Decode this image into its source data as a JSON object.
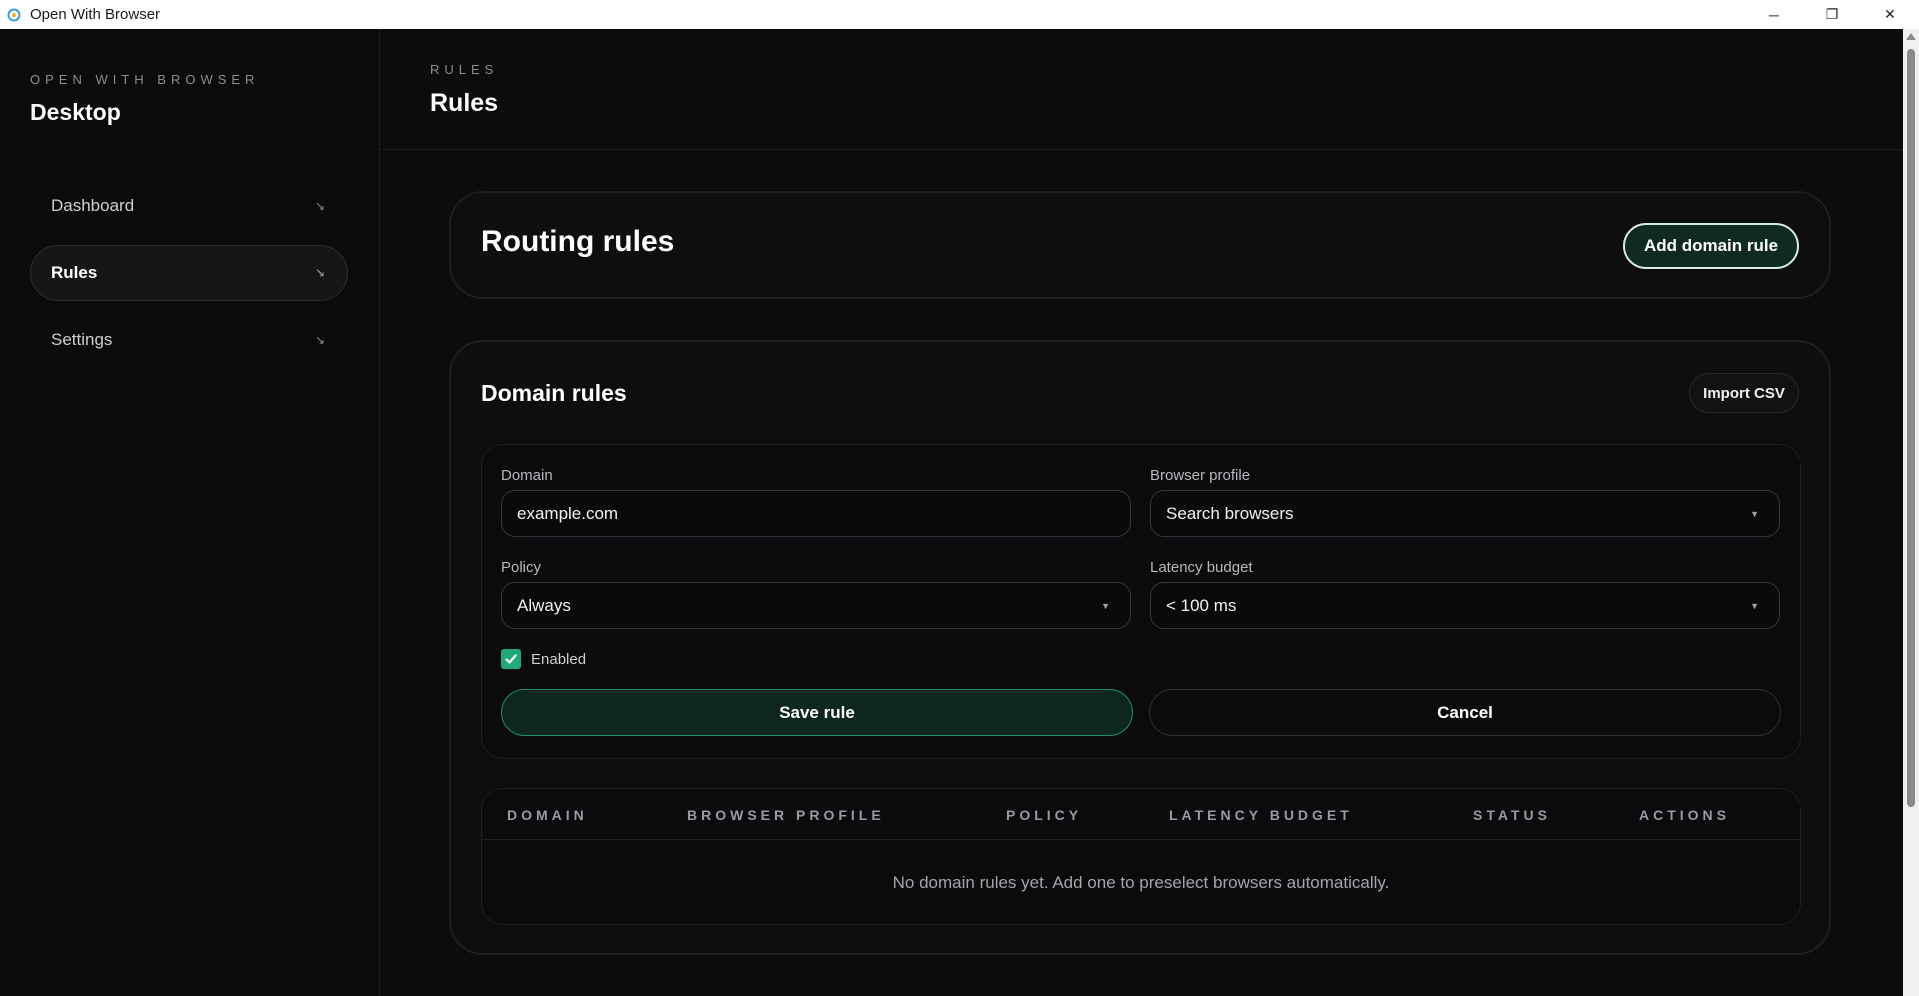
{
  "window": {
    "title": "Open With Browser",
    "minimize": "─",
    "maximize": "❐",
    "close": "✕"
  },
  "sidebar": {
    "kicker": "OPEN WITH BROWSER",
    "title": "Desktop",
    "items": [
      {
        "label": "Dashboard",
        "arrow": "↘",
        "active": false
      },
      {
        "label": "Rules",
        "arrow": "↘",
        "active": true
      },
      {
        "label": "Settings",
        "arrow": "↘",
        "active": false
      }
    ]
  },
  "header": {
    "crumb": "RULES",
    "title": "Rules"
  },
  "hero": {
    "title": "Routing rules",
    "add_button": "Add domain rule"
  },
  "domain_rules": {
    "title": "Domain rules",
    "import_button": "Import CSV",
    "form": {
      "domain_label": "Domain",
      "domain_value": "example.com",
      "profile_label": "Browser profile",
      "profile_value": "Search browsers",
      "policy_label": "Policy",
      "policy_value": "Always",
      "latency_label": "Latency budget",
      "latency_value": "< 100 ms",
      "enabled_label": "Enabled",
      "enabled": true,
      "save_button": "Save rule",
      "cancel_button": "Cancel"
    },
    "table": {
      "columns": [
        "DOMAIN",
        "BROWSER PROFILE",
        "POLICY",
        "LATENCY BUDGET",
        "STATUS",
        "ACTIONS"
      ],
      "empty_message": "No domain rules yet. Add one to preselect browsers automatically."
    }
  },
  "colors": {
    "background": "#0c0c0d",
    "accent": "#1fa97b",
    "accent_dark": "#0d2620"
  }
}
